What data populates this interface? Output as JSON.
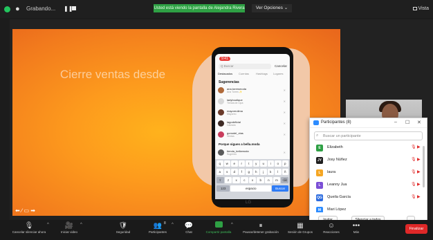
{
  "topbar": {
    "recording_label": "Grabando...",
    "share_banner": "Usted está viendo la pantalla de Alejandra Rivera",
    "view_options": "Ver Opciones ⌄",
    "view_label": "Vista"
  },
  "slide": {
    "title": "Cierre ventas desde"
  },
  "phone": {
    "status_time": "9:41",
    "search_placeholder": "Q Buscar",
    "cancel": "Cancelar",
    "tabs": [
      "Destacados",
      "Cuentas",
      "Hashtags",
      "Lugares"
    ],
    "suggestions_heading": "Sugerencias",
    "suggestions": [
      {
        "name": "ana.torresmoda",
        "sub": "Ana Torres ✨"
      },
      {
        "name": "ladyboutique",
        "sub": "Tienda de ropa"
      },
      {
        "name": "mayoreolima",
        "sub": "Mayoreo"
      },
      {
        "name": "lagodeficial",
        "sub": "Calzado"
      },
      {
        "name": "gomotel_vtas",
        "sub": "Ventas"
      }
    ],
    "why_heading": "Porque sigues a bella.moda",
    "why_row": {
      "name": "tienda_bellamoda",
      "sub": "Sugerido"
    },
    "keyboard": {
      "row1": [
        "q",
        "w",
        "e",
        "r",
        "t",
        "y",
        "u",
        "i",
        "o",
        "p"
      ],
      "row2": [
        "a",
        "s",
        "d",
        "f",
        "g",
        "h",
        "j",
        "k",
        "l",
        "ñ"
      ],
      "row3": [
        "⇧",
        "z",
        "x",
        "c",
        "v",
        "b",
        "n",
        "m",
        "⌫"
      ],
      "row4": [
        "123",
        "espacio",
        "Buscar"
      ]
    },
    "brand": "LG"
  },
  "participants_panel": {
    "title": "Participantes (8)",
    "search_placeholder": "Buscar un participante",
    "participants": [
      {
        "initials": "E",
        "name": "Elizabeth",
        "color": "#2ea044"
      },
      {
        "initials": "JY",
        "name": "Josy Núñez",
        "color": "#1f1f1f"
      },
      {
        "initials": "L",
        "name": "laura",
        "color": "#f5a623"
      },
      {
        "initials": "L",
        "name": "Leanny Jua",
        "color": "#7b4fd6"
      },
      {
        "initials": "QG",
        "name": "Queila García",
        "color": "#2d6cdf"
      },
      {
        "initials": "M",
        "name": "Mari López",
        "color": "#2d8cff"
      }
    ],
    "invite": "Invitar",
    "mute_all": "Silenciar a todos",
    "more": "..."
  },
  "bottombar": {
    "items": [
      {
        "icon": "🎙",
        "label": "Cancelar silenciar ahora"
      },
      {
        "icon": "🎥",
        "label": "Iniciar video"
      },
      {
        "icon": "🛡",
        "label": "Seguridad"
      },
      {
        "icon": "👥",
        "label": "Participantes",
        "count": "8"
      },
      {
        "icon": "💬",
        "label": "Chat"
      },
      {
        "icon": "⬆",
        "label": "Compartir pantalla"
      },
      {
        "icon": "⏸",
        "label": "Pausar/detener grabación"
      },
      {
        "icon": "▦",
        "label": "Sesión de Grupos"
      },
      {
        "icon": "☺",
        "label": "Reacciones"
      },
      {
        "icon": "•••",
        "label": "Más"
      }
    ],
    "end": "Finalizar"
  }
}
